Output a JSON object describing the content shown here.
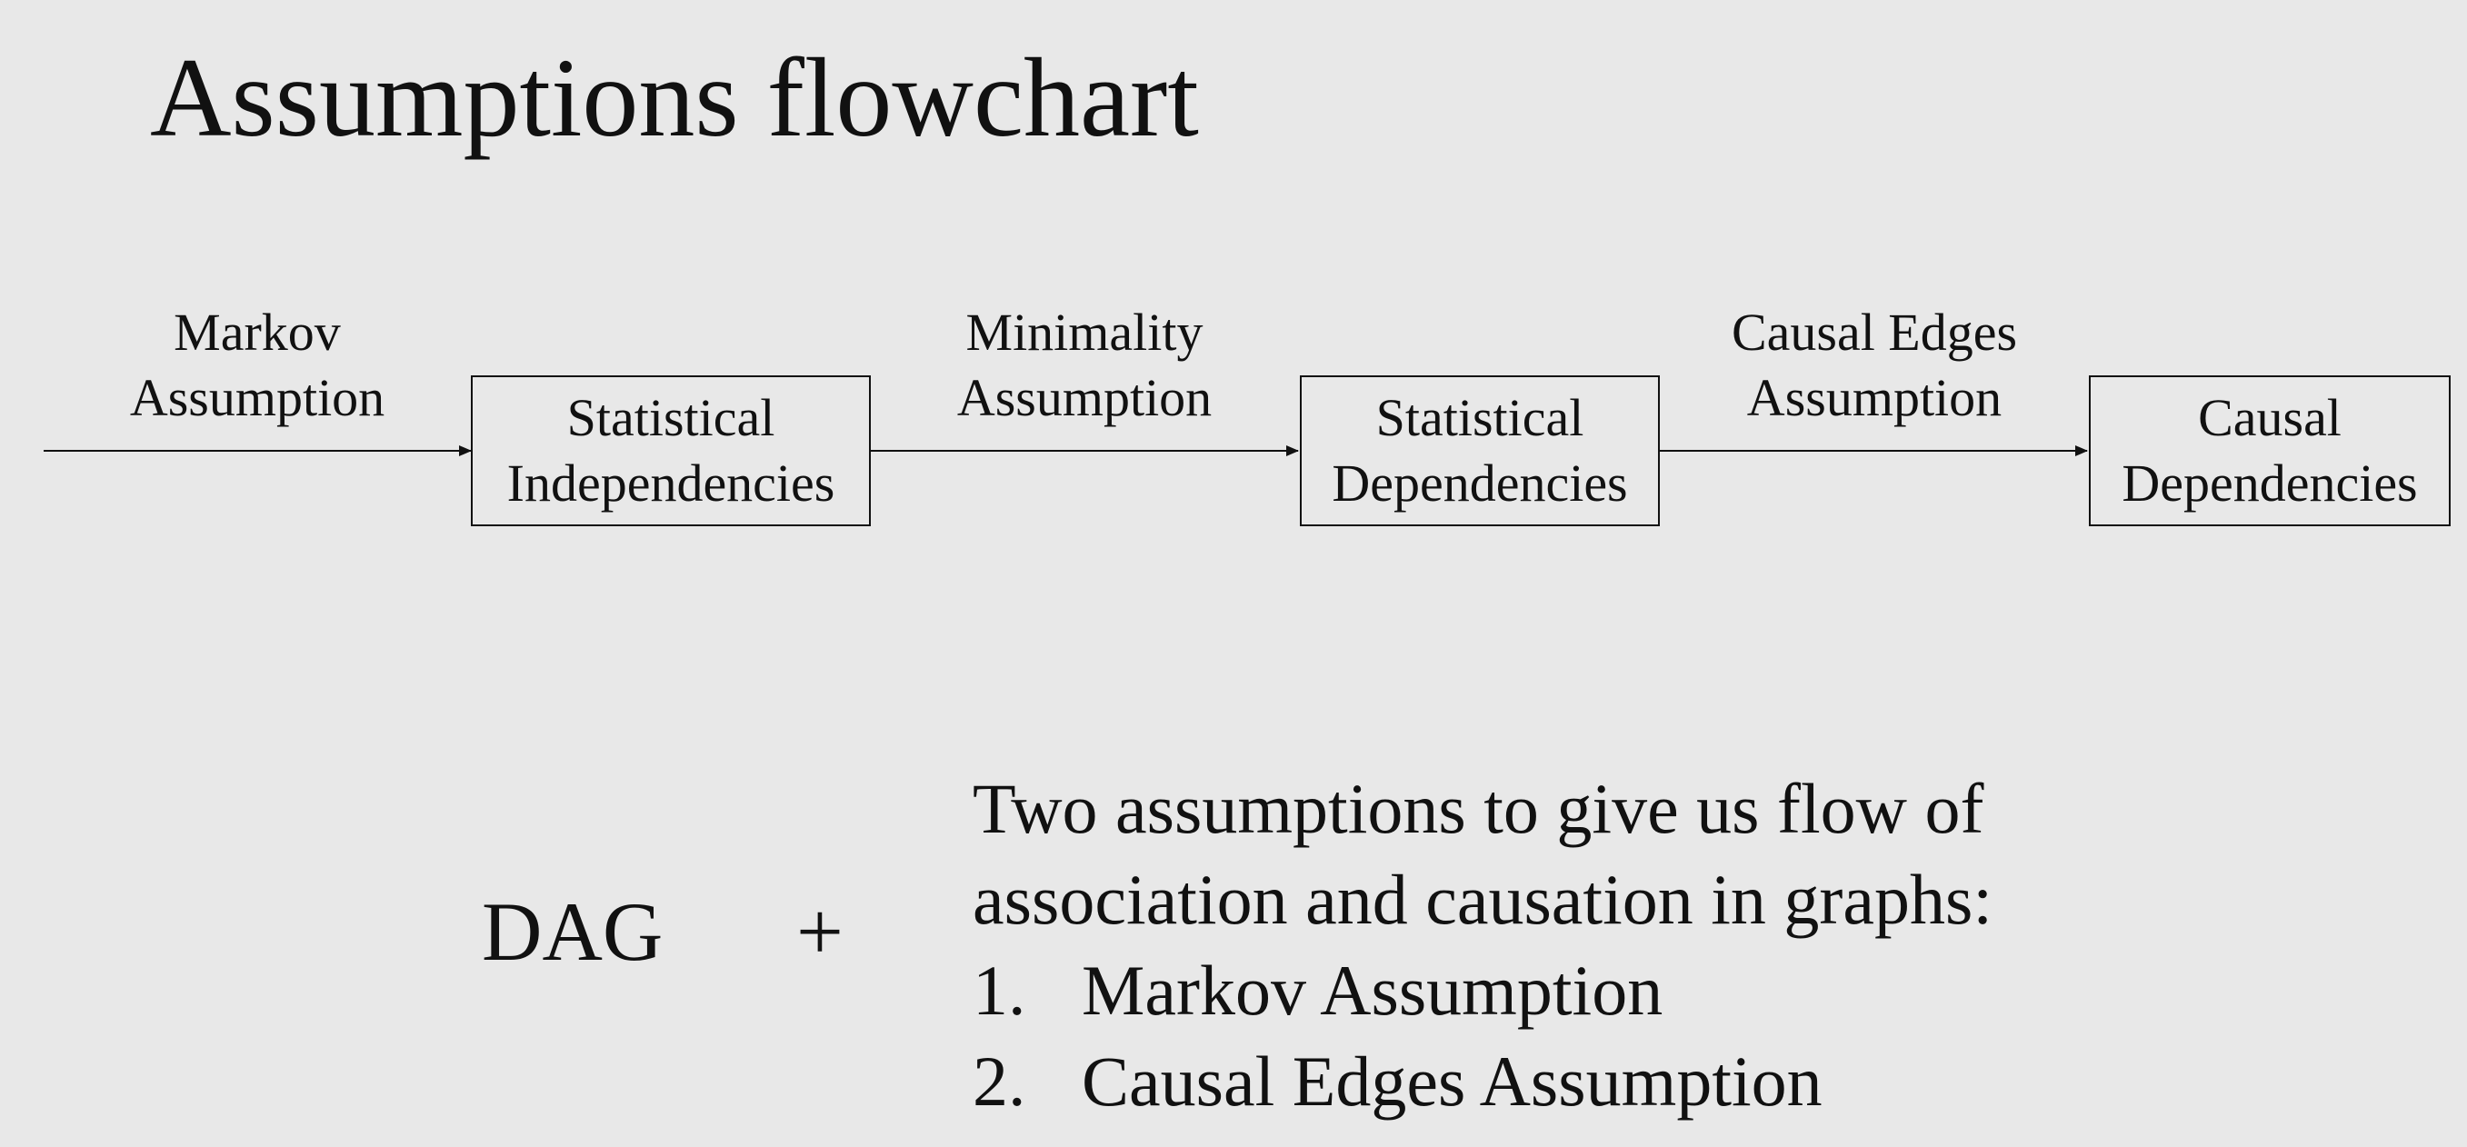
{
  "title": "Assumptions flowchart",
  "flow": {
    "nodes": [
      {
        "line1": "Statistical",
        "line2": "Independencies"
      },
      {
        "line1": "Statistical",
        "line2": "Dependencies"
      },
      {
        "line1": "Causal",
        "line2": "Dependencies"
      }
    ],
    "edges": [
      {
        "line1": "Markov",
        "line2": "Assumption"
      },
      {
        "line1": "Minimality",
        "line2": "Assumption"
      },
      {
        "line1": "Causal Edges",
        "line2": "Assumption"
      }
    ]
  },
  "bottom": {
    "dag": "DAG",
    "plus": "+",
    "intro_line1": "Two assumptions to give us flow of",
    "intro_line2": "association and causation in graphs:",
    "items": [
      {
        "num": "1.",
        "text": "Markov Assumption"
      },
      {
        "num": "2.",
        "text": "Causal Edges Assumption"
      }
    ]
  }
}
